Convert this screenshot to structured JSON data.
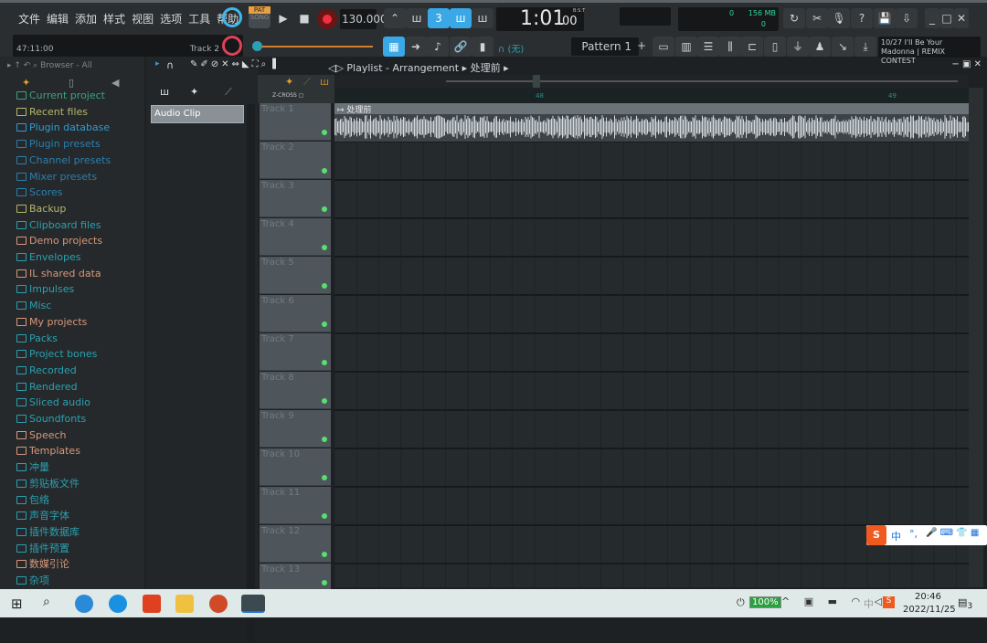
{
  "menu": [
    "文件",
    "编辑",
    "添加",
    "样式",
    "视图",
    "选项",
    "工具",
    "帮助"
  ],
  "hint": {
    "time": "47:11:00",
    "track": "Track 2"
  },
  "transport": {
    "pat": "PAT",
    "song": "SONG",
    "tempo": "130.000",
    "time": "1:01",
    "time_sub": "00",
    "bst": "B:S:T",
    "cpu": "0",
    "mem": "156 MB",
    "poly": "0"
  },
  "pattern": "Pattern 1",
  "snap": "(无)",
  "news": {
    "line1": "10/27  I'll Be Your",
    "line2": "Madonna | REMIX CONTEST"
  },
  "browser": {
    "title": "Browser - All",
    "items": [
      {
        "label": "Current project",
        "color": "#3aa37e"
      },
      {
        "label": "Recent files",
        "color": "#b4b86a"
      },
      {
        "label": "Plugin database",
        "color": "#2f9bd0"
      },
      {
        "label": "Plugin presets",
        "color": "#2a7fae"
      },
      {
        "label": "Channel presets",
        "color": "#2a7fae"
      },
      {
        "label": "Mixer presets",
        "color": "#2a7fae"
      },
      {
        "label": "Scores",
        "color": "#2a7fae"
      },
      {
        "label": "Backup",
        "color": "#b4b86a"
      },
      {
        "label": "Clipboard files",
        "color": "#2aa0b0"
      },
      {
        "label": "Demo projects",
        "color": "#d8987a"
      },
      {
        "label": "Envelopes",
        "color": "#2aa0b0"
      },
      {
        "label": "IL shared data",
        "color": "#d8987a"
      },
      {
        "label": "Impulses",
        "color": "#2aa0b0"
      },
      {
        "label": "Misc",
        "color": "#2aa0b0"
      },
      {
        "label": "My projects",
        "color": "#d8987a"
      },
      {
        "label": "Packs",
        "color": "#2aa0b0"
      },
      {
        "label": "Project bones",
        "color": "#2aa0b0"
      },
      {
        "label": "Recorded",
        "color": "#2aa0b0"
      },
      {
        "label": "Rendered",
        "color": "#2aa0b0"
      },
      {
        "label": "Sliced audio",
        "color": "#2aa0b0"
      },
      {
        "label": "Soundfonts",
        "color": "#2aa0b0"
      },
      {
        "label": "Speech",
        "color": "#d8987a"
      },
      {
        "label": "Templates",
        "color": "#d8987a"
      },
      {
        "label": "冲量",
        "color": "#2aa0b0"
      },
      {
        "label": "剪贴板文件",
        "color": "#2aa0b0"
      },
      {
        "label": "包络",
        "color": "#2aa0b0"
      },
      {
        "label": "声音字体",
        "color": "#2aa0b0"
      },
      {
        "label": "插件数据库",
        "color": "#2aa0b0"
      },
      {
        "label": "插件预置",
        "color": "#2aa0b0"
      },
      {
        "label": "数媒引论",
        "color": "#d8987a"
      },
      {
        "label": "杂项",
        "color": "#2aa0b0"
      }
    ]
  },
  "picker": {
    "clip": "Audio Clip"
  },
  "playlist": {
    "title": "Playlist - Arrangement",
    "pattern": "处理前",
    "zcross": "Z-CROSS",
    "bars": [
      "48",
      "49"
    ],
    "clip_name": "处理前",
    "tracks": [
      "Track 1",
      "Track 2",
      "Track 3",
      "Track 4",
      "Track 5",
      "Track 6",
      "Track 7",
      "Track 8",
      "Track 9",
      "Track 10",
      "Track 11",
      "Track 12",
      "Track 13"
    ]
  },
  "ime": {
    "mode": "中",
    "punct": "°,"
  },
  "taskbar": {
    "battery": "100%",
    "ime": "中",
    "time": "20:46",
    "date": "2022/11/25",
    "notifications": "3"
  }
}
